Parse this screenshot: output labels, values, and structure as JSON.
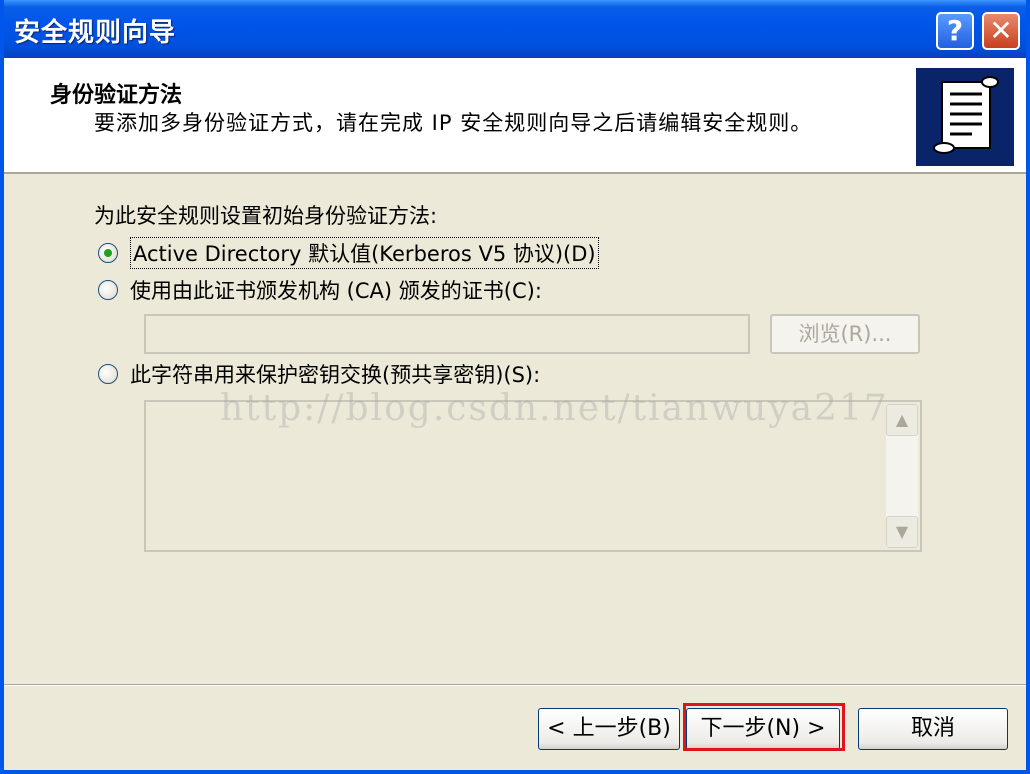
{
  "window": {
    "title": "安全规则向导",
    "help_label": "?",
    "close_label": "✕"
  },
  "header": {
    "title": "身份验证方法",
    "subtitle": "要添加多身份验证方式，请在完成 IP 安全规则向导之后请编辑安全规则。",
    "icon": "scroll-document-icon"
  },
  "main": {
    "instruction": "为此安全规则设置初始身份验证方法:",
    "options": [
      {
        "label": "Active Directory 默认值(Kerberos V5 协议)(D)",
        "checked": true
      },
      {
        "label": "使用由此证书颁发机构 (CA) 颁发的证书(C):",
        "checked": false
      },
      {
        "label": "此字符串用来保护密钥交换(预共享密钥)(S):",
        "checked": false
      }
    ],
    "certificate_value": "",
    "browse_label": "浏览(R)...",
    "preshared_key_value": "",
    "watermark": "http://blog.csdn.net/tianwuya217"
  },
  "footer": {
    "back_label": "< 上一步(B)",
    "next_label": "下一步(N) >",
    "cancel_label": "取消"
  },
  "colors": {
    "titlebar": "#0055EA",
    "highlight": "#E0141E",
    "dialog_bg": "#ECE9D8"
  }
}
